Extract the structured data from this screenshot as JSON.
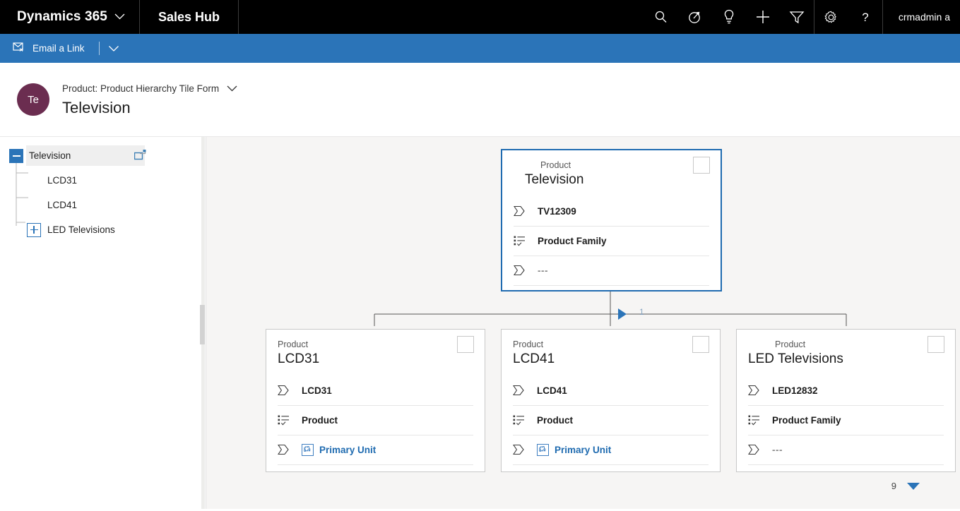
{
  "topnav": {
    "brand": "Dynamics 365",
    "brand_chevron_icon": "chevron-down-icon",
    "app_name": "Sales Hub",
    "icons": [
      {
        "name": "search-icon",
        "label": "Search"
      },
      {
        "name": "assistant-icon",
        "label": "Assistant"
      },
      {
        "name": "lightbulb-icon",
        "label": "Ideas"
      },
      {
        "name": "plus-icon",
        "label": "Quick Create"
      },
      {
        "name": "filter-icon",
        "label": "Filter"
      }
    ],
    "icons_right": [
      {
        "name": "gear-icon",
        "label": "Settings"
      },
      {
        "name": "help-icon",
        "label": "Help"
      }
    ],
    "user": "crmadmin a"
  },
  "commandbar": {
    "email_link_icon": "email-link-icon",
    "email_link_label": "Email a Link",
    "overflow_icon": "chevron-down-icon"
  },
  "record_header": {
    "avatar_initials": "Te",
    "avatar_color": "#6b2d50",
    "form_name": "Product: Product Hierarchy Tile Form",
    "form_chevron_icon": "chevron-down-icon",
    "record_name": "Television"
  },
  "tree": {
    "nodes": [
      {
        "label": "Television",
        "level": 0,
        "toggle": "minus",
        "selected": true,
        "popout_icon": "open-in-new-window-icon"
      },
      {
        "label": "LCD31",
        "level": 1,
        "toggle": "none",
        "selected": false
      },
      {
        "label": "LCD41",
        "level": 1,
        "toggle": "none",
        "selected": false
      },
      {
        "label": "LED Televisions",
        "level": 1,
        "toggle": "plus",
        "selected": false
      }
    ]
  },
  "hierarchy": {
    "connector_count": "1",
    "parent": {
      "type_label": "Product",
      "title": "Television",
      "selected": true,
      "checkbox_checked": false,
      "rows": [
        {
          "icon": "text-field-icon",
          "value": "TV12309",
          "link": false
        },
        {
          "icon": "option-set-icon",
          "value": "Product Family",
          "link": false
        },
        {
          "icon": "text-field-icon",
          "value": "---",
          "link": false,
          "dim": true
        }
      ]
    },
    "children": [
      {
        "type_label": "Product",
        "title": "LCD31",
        "checkbox_checked": false,
        "rows": [
          {
            "icon": "text-field-icon",
            "value": "LCD31",
            "link": false
          },
          {
            "icon": "option-set-icon",
            "value": "Product",
            "link": false
          },
          {
            "icon": "text-field-icon",
            "value": "Primary Unit",
            "link": true,
            "link_icon": "lookup-icon"
          }
        ]
      },
      {
        "type_label": "Product",
        "title": "LCD41",
        "checkbox_checked": false,
        "rows": [
          {
            "icon": "text-field-icon",
            "value": "LCD41",
            "link": false
          },
          {
            "icon": "option-set-icon",
            "value": "Product",
            "link": false
          },
          {
            "icon": "text-field-icon",
            "value": "Primary Unit",
            "link": true,
            "link_icon": "lookup-icon"
          }
        ]
      },
      {
        "type_label": "Product",
        "title": "LED Televisions",
        "checkbox_checked": false,
        "rows": [
          {
            "icon": "text-field-icon",
            "value": "LED12832",
            "link": false
          },
          {
            "icon": "option-set-icon",
            "value": "Product Family",
            "link": false
          },
          {
            "icon": "text-field-icon",
            "value": "---",
            "link": false,
            "dim": true
          }
        ]
      }
    ]
  },
  "pager": {
    "page_number": "9",
    "next_icon": "triangle-down-icon"
  },
  "colors": {
    "topnav_bg": "#000000",
    "command_bar_bg": "#2b74b8",
    "accent_blue": "#1f6bb0",
    "canvas_bg": "#f6f5f4",
    "link_blue": "#1f6bb0"
  }
}
